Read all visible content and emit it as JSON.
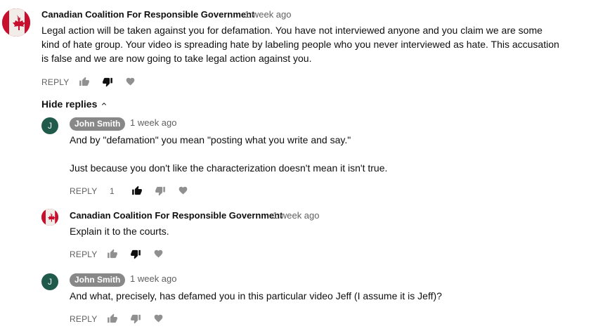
{
  "comment": {
    "author": "Canadian Coalition For Responsible Government",
    "time": "1 week ago",
    "text": "Legal action will be taken against you for defamation. You have not interviewed anyone and you claim we are some kind of hate group. Your video is spreading hate by labeling people who you never interviewed as hate. This accusation is false and we are now going to take legal action against you.",
    "reply_label": "REPLY",
    "toggle_label": "Hide replies",
    "disliked": true
  },
  "replies": [
    {
      "avatar_letter": "J",
      "author": "John Smith",
      "time": "1 week ago",
      "line1": "And by \"defamation\" you mean \"posting what you write and say.\"",
      "line2": "Just because you don't like the characterization doesn't mean it isn't true.",
      "reply_label": "REPLY",
      "like_count": "1",
      "liked": true
    },
    {
      "author": "Canadian Coalition For Responsible Government",
      "time": "1 week ago",
      "line1": "Explain it to the courts.",
      "reply_label": "REPLY",
      "disliked": true
    },
    {
      "avatar_letter": "J",
      "author": "John Smith",
      "time": "1 week ago",
      "line1": "And what, precisely, has defamed you in this particular video Jeff (I assume it is Jeff)?",
      "reply_label": "REPLY"
    }
  ],
  "colors": {
    "like_active": "#0f0f0f",
    "like_inactive": "#909090",
    "author_chip_bg": "#888888",
    "avatar_j_bg": "#1f5a4a",
    "flag_red": "#c8102e"
  },
  "icons": [
    "thumbs-up-icon",
    "thumbs-down-icon",
    "heart-icon",
    "chevron-up-icon",
    "maple-leaf-icon"
  ]
}
